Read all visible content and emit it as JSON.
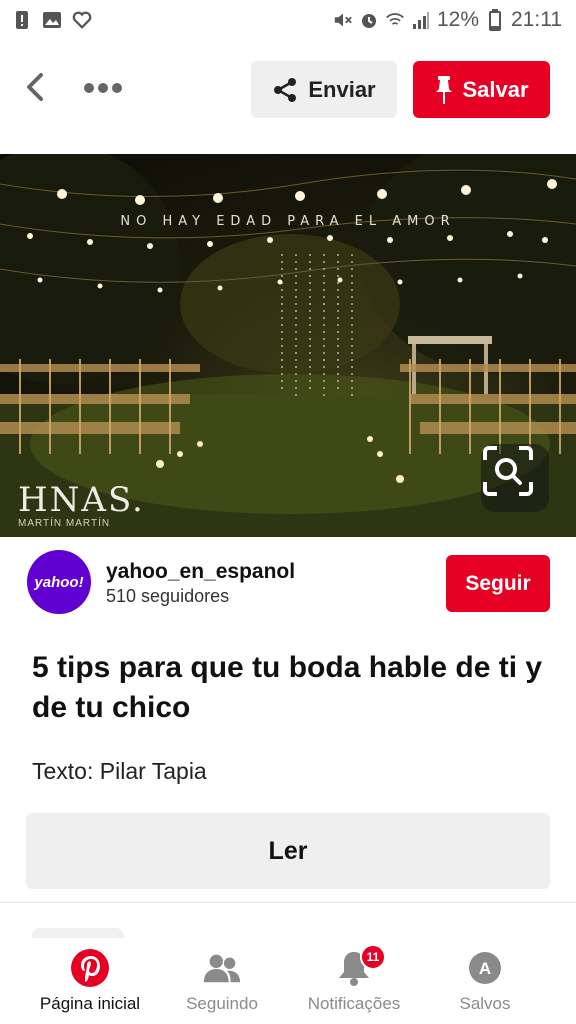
{
  "status_bar": {
    "battery_percent": "12%",
    "time": "21:11",
    "left_icons": [
      "alert-icon",
      "image-icon",
      "heart-outline-icon"
    ],
    "right_icons": [
      "mute-icon",
      "alarm-icon",
      "wifi-icon",
      "signal-icon",
      "battery-icon"
    ]
  },
  "toolbar": {
    "send_label": "Enviar",
    "save_label": "Salvar"
  },
  "pin": {
    "image_caption": "NO HAY EDAD PARA EL AMOR",
    "image_brand": "HNAS.",
    "image_brand_sub": "MARTÍN MARTÍN",
    "title": "5 tips para que tu boda hable de ti y de tu chico",
    "description": "Texto: Pilar Tapia",
    "read_label": "Ler"
  },
  "profile": {
    "avatar_text": "yahoo!",
    "name": "yahoo_en_espanol",
    "followers": "510 seguidores",
    "follow_label": "Seguir"
  },
  "bottom_nav": {
    "items": [
      {
        "label": "Página inicial",
        "icon": "pinterest-icon",
        "active": true
      },
      {
        "label": "Seguindo",
        "icon": "people-icon",
        "active": false
      },
      {
        "label": "Notificações",
        "icon": "bell-icon",
        "active": false,
        "badge": "11"
      },
      {
        "label": "Salvos",
        "icon": "profile-initial-icon",
        "initial": "A",
        "active": false
      }
    ]
  },
  "colors": {
    "accent": "#e60023",
    "secondary_button": "#efefef",
    "avatar_bg": "#6001d2"
  }
}
